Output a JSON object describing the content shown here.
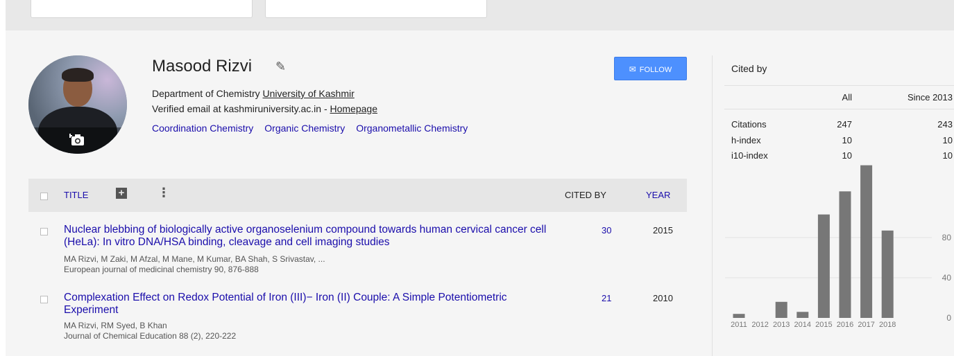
{
  "profile": {
    "name": "Masood Rizvi",
    "department_prefix": "Department of Chemistry ",
    "university": "University of Kashmir",
    "email_text": "Verified email at kashmiruniversity.ac.in - ",
    "homepage": "Homepage",
    "interests": [
      "Coordination Chemistry",
      "Organic Chemistry",
      "Organometallic Chemistry"
    ],
    "follow_label": "FOLLOW"
  },
  "table": {
    "title_header": "TITLE",
    "cited_header": "CITED BY",
    "year_header": "YEAR"
  },
  "articles": [
    {
      "title": "Nuclear blebbing of biologically active organoselenium compound towards human cervical cancer cell (HeLa): In vitro DNA/HSA binding, cleavage and cell imaging studies",
      "authors": "MA Rizvi, M Zaki, M Afzal, M Mane, M Kumar, BA Shah, S Srivastav, ...",
      "venue": "European journal of medicinal chemistry 90, 876-888",
      "cited_by": "30",
      "year": "2015"
    },
    {
      "title": "Complexation Effect on Redox Potential of Iron (III)− Iron (II) Couple: A Simple Potentiometric Experiment",
      "authors": "MA Rizvi, RM Syed, B Khan",
      "venue": "Journal of Chemical Education 88 (2), 220-222",
      "cited_by": "21",
      "year": "2010"
    }
  ],
  "cited_by": {
    "title": "Cited by",
    "col_all": "All",
    "col_since": "Since 2013",
    "rows": [
      {
        "label": "Citations",
        "all": "247",
        "since": "243"
      },
      {
        "label": "h-index",
        "all": "10",
        "since": "10"
      },
      {
        "label": "i10-index",
        "all": "10",
        "since": "10"
      }
    ]
  },
  "chart_data": {
    "type": "bar",
    "categories": [
      "2011",
      "2012",
      "2013",
      "2014",
      "2015",
      "2016",
      "2017",
      "2018"
    ],
    "values": [
      4,
      0,
      16,
      6,
      103,
      126,
      152,
      87
    ],
    "ylim": [
      0,
      180
    ],
    "ytick_values": [
      0,
      40,
      80
    ],
    "ytick_labels": [
      "0",
      "40",
      "80"
    ],
    "bar_color": "#777777",
    "grid": true
  }
}
